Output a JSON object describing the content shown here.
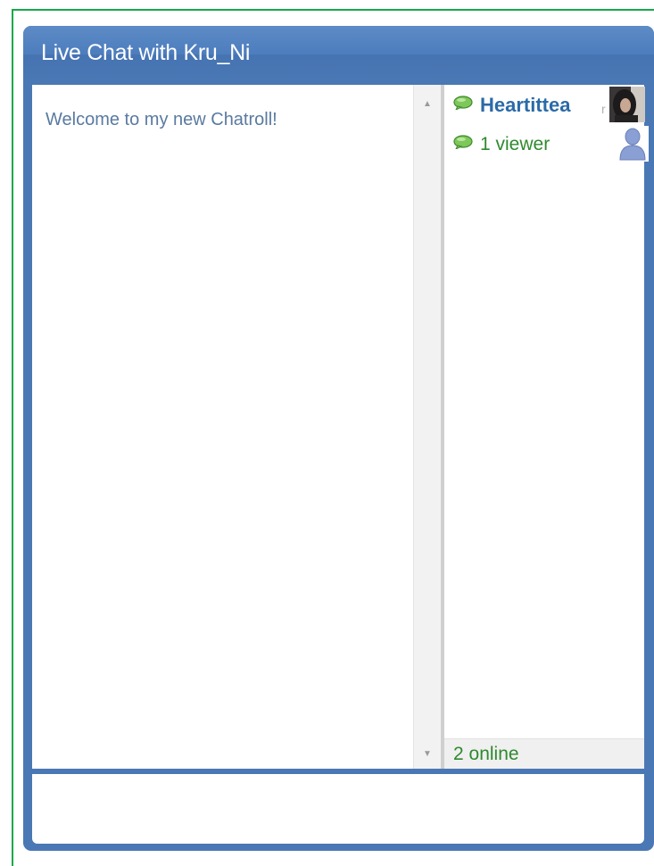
{
  "window": {
    "title": "Live Chat with Kru_Ni"
  },
  "messages": [
    {
      "text": "Welcome to my new Chatroll!"
    }
  ],
  "users": [
    {
      "name": "Heartittea",
      "truncation": "r",
      "icon": "chat-bubble-icon",
      "avatar": "user-photo-avatar"
    },
    {
      "name": "1 viewer",
      "icon": "chat-bubble-icon",
      "avatar": "generic-user-avatar"
    }
  ],
  "status": {
    "online": "2 online"
  },
  "colors": {
    "frame_blue": "#4a78b4",
    "online_green": "#2e8a2e",
    "username_blue": "#2b6aa8",
    "message_text": "#5a7aa0",
    "outer_border_green": "#16a84a"
  },
  "icons": {
    "scroll_up": "▲",
    "scroll_down": "▼"
  }
}
